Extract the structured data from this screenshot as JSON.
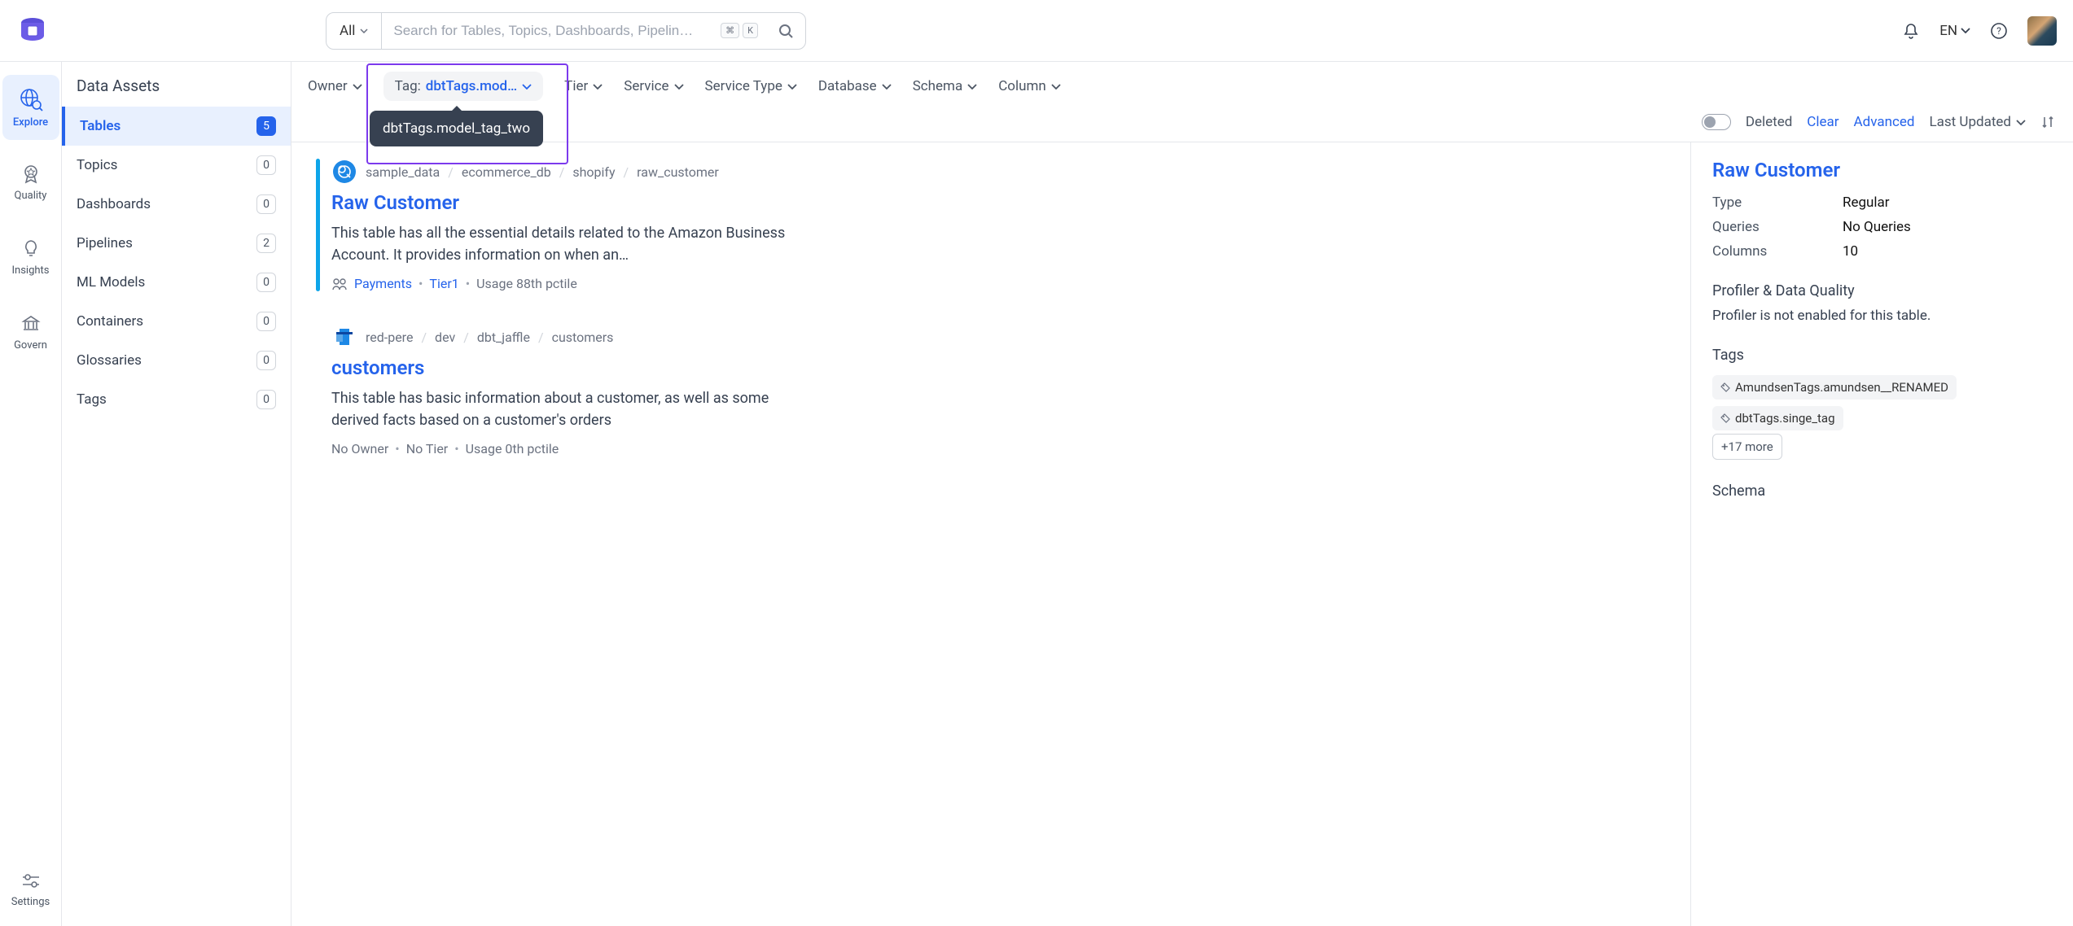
{
  "header": {
    "search_all": "All",
    "search_placeholder": "Search for Tables, Topics, Dashboards, Pipelin…",
    "kbd1": "⌘",
    "kbd2": "K",
    "lang": "EN"
  },
  "rail": {
    "items": [
      {
        "label": "Explore",
        "icon": "globe-search-icon"
      },
      {
        "label": "Quality",
        "icon": "badge-icon"
      },
      {
        "label": "Insights",
        "icon": "bulb-icon"
      },
      {
        "label": "Govern",
        "icon": "govern-icon"
      },
      {
        "label": "Settings",
        "icon": "sliders-icon"
      }
    ]
  },
  "secondary": {
    "title": "Data Assets",
    "items": [
      {
        "label": "Tables",
        "count": "5",
        "active": true
      },
      {
        "label": "Topics",
        "count": "0"
      },
      {
        "label": "Dashboards",
        "count": "0"
      },
      {
        "label": "Pipelines",
        "count": "2"
      },
      {
        "label": "ML Models",
        "count": "0"
      },
      {
        "label": "Containers",
        "count": "0"
      },
      {
        "label": "Glossaries",
        "count": "0"
      },
      {
        "label": "Tags",
        "count": "0"
      }
    ]
  },
  "filters": {
    "owner": "Owner",
    "tag_label": "Tag:",
    "tag_value": "dbtTags.mod…",
    "tag_tooltip": "dbtTags.model_tag_two",
    "tier": "Tier",
    "service": "Service",
    "service_type": "Service Type",
    "database": "Database",
    "schema": "Schema",
    "column": "Column",
    "deleted": "Deleted",
    "clear": "Clear",
    "advanced": "Advanced",
    "last_updated": "Last Updated"
  },
  "results": [
    {
      "active": true,
      "icon_color": "#1e88e5",
      "crumbs": [
        "sample_data",
        "ecommerce_db",
        "shopify",
        "raw_customer"
      ],
      "title": "Raw Customer",
      "desc": "This table has all the essential details related to the Amazon Business Account. It provides information on when an…",
      "owner": "Payments",
      "tier": "Tier1",
      "usage": "Usage 88th pctile"
    },
    {
      "active": false,
      "icon_color": "#1e88e5",
      "crumbs": [
        "red-pere",
        "dev",
        "dbt_jaffle",
        "customers"
      ],
      "title": "customers",
      "desc": "This table has basic information about a customer, as well as some derived facts based on a customer's orders",
      "owner": "No Owner",
      "tier": "No Tier",
      "usage": "Usage 0th pctile"
    }
  ],
  "detail": {
    "title": "Raw Customer",
    "rows": [
      {
        "k": "Type",
        "v": "Regular"
      },
      {
        "k": "Queries",
        "v": "No Queries"
      },
      {
        "k": "Columns",
        "v": "10"
      }
    ],
    "profiler_heading": "Profiler & Data Quality",
    "profiler_text": "Profiler is not enabled for this table.",
    "tags_heading": "Tags",
    "tags": [
      "AmundsenTags.amundsen__RENAMED",
      "dbtTags.singe_tag"
    ],
    "more_tags": "+17 more",
    "schema_heading": "Schema"
  }
}
